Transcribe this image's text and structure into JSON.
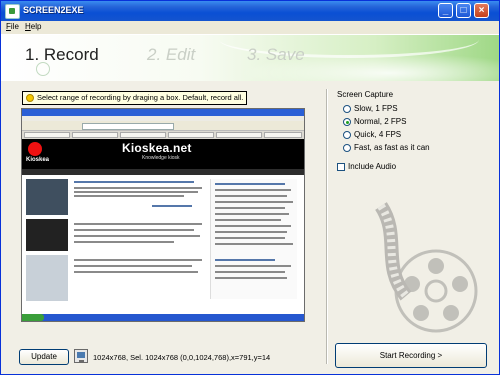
{
  "window": {
    "title": "SCREEN2EXE"
  },
  "titlebar_buttons": {
    "minimize": "_",
    "maximize": "□",
    "close": "×"
  },
  "menu": {
    "items": [
      "File",
      "Help"
    ]
  },
  "steps": [
    {
      "label": "1. Record",
      "active": true
    },
    {
      "label": "2. Edit",
      "active": false
    },
    {
      "label": "3. Save",
      "active": false
    }
  ],
  "hint": {
    "text": "Select range of recording by draging a box. Default, record all."
  },
  "preview": {
    "site_brand": "Kioskea.net",
    "site_brand_sub": "Knowledge kiosk",
    "site_logo_text": "Kioskea"
  },
  "bottom": {
    "update_label": "Update",
    "status": "1024x768, Sel. 1024x768 (0,0,1024,768),x=791,y=14"
  },
  "capture": {
    "title": "Screen Capture",
    "options": [
      {
        "label": "Slow, 1 FPS",
        "selected": false
      },
      {
        "label": "Normal, 2 FPS",
        "selected": true
      },
      {
        "label": "Quick, 4 FPS",
        "selected": false
      },
      {
        "label": "Fast, as fast as it can",
        "selected": false
      }
    ],
    "include_audio_label": "Include Audio",
    "include_audio": false,
    "start_label": "Start Recording >"
  },
  "colors": {
    "titlebar": "#0a4fd4",
    "accent_green": "#9fd886",
    "window_bg": "#f1efe6"
  }
}
